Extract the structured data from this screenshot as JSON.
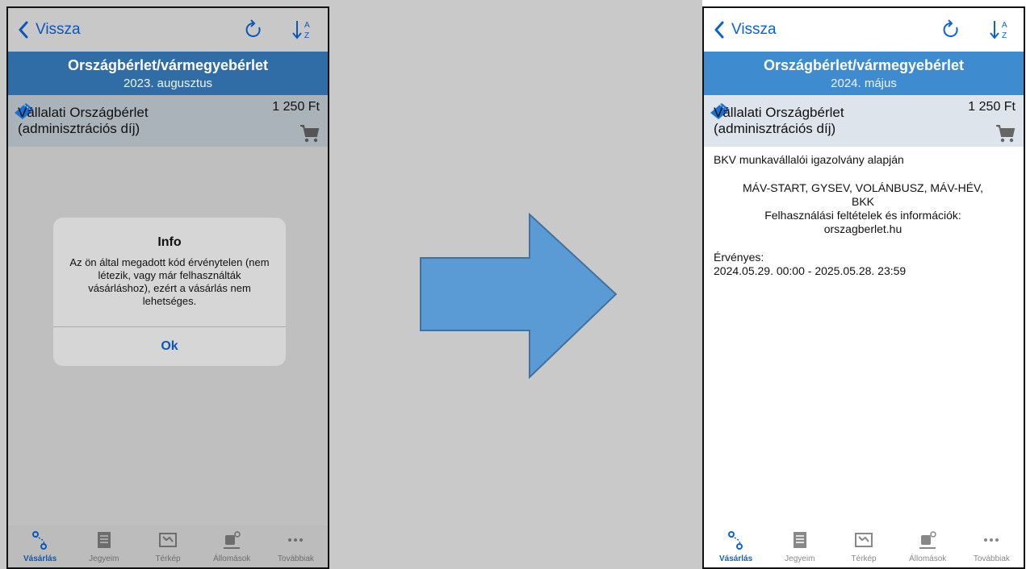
{
  "left": {
    "nav": {
      "back_label": "Vissza"
    },
    "header": {
      "title": "Országbérlet/vármegyebérlet",
      "subtitle": "2023. augusztus"
    },
    "ticket": {
      "name_line1": "Vállalati Országbérlet",
      "name_line2": "(adminisztrációs díj)",
      "price": "1 250 Ft"
    },
    "dialog": {
      "title": "Info",
      "message": "Az ön által megadott kód érvénytelen (nem létezik, vagy már felhasználták vásárláshoz), ezért a vásárlás nem lehetséges.",
      "ok_label": "Ok"
    },
    "tabs": [
      {
        "label": "Vásárlás",
        "icon": "route-icon",
        "active": true
      },
      {
        "label": "Jegyeim",
        "icon": "list-icon",
        "active": false
      },
      {
        "label": "Térkép",
        "icon": "map-icon",
        "active": false
      },
      {
        "label": "Állomások",
        "icon": "train-station-icon",
        "active": false
      },
      {
        "label": "Továbbiak",
        "icon": "more-icon",
        "active": false
      }
    ]
  },
  "right": {
    "nav": {
      "back_label": "Vissza"
    },
    "header": {
      "title": "Országbérlet/vármegyebérlet",
      "subtitle": "2024. május"
    },
    "ticket": {
      "name_line1": "Vállalati Országbérlet",
      "name_line2": "(adminisztrációs díj)",
      "price": "1 250 Ft"
    },
    "details": {
      "basis": "BKV munkavállalói igazolvány alapján",
      "operators_line1": "MÁV-START, GYSEV, VOLÁNBUSZ, MÁV-HÉV,",
      "operators_line2": "BKK",
      "info_label": "Felhasználási feltételek és információk:",
      "info_site": "orszagberlet.hu",
      "valid_label": "Érvényes:",
      "valid_range": "2024.05.29. 00:00 - 2025.05.28. 23:59"
    },
    "tabs": [
      {
        "label": "Vásárlás",
        "icon": "route-icon",
        "active": true
      },
      {
        "label": "Jegyeim",
        "icon": "list-icon",
        "active": false
      },
      {
        "label": "Térkép",
        "icon": "map-icon",
        "active": false
      },
      {
        "label": "Állomások",
        "icon": "train-station-icon",
        "active": false
      },
      {
        "label": "Továbbiak",
        "icon": "more-icon",
        "active": false
      }
    ]
  },
  "colors": {
    "accent": "#0a62d6",
    "header_blue": "#3f8bd0",
    "arrow_fill": "#5b9bd5",
    "arrow_stroke": "#41719c"
  }
}
